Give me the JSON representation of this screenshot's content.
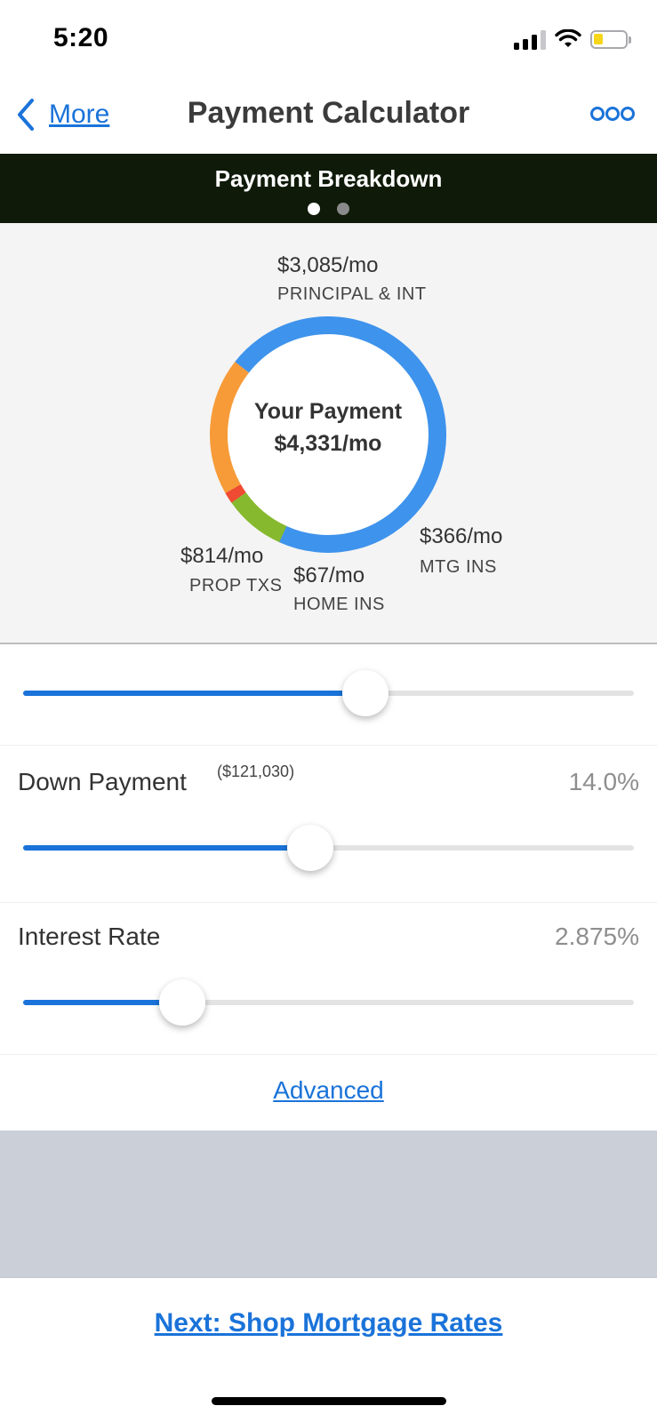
{
  "status_bar": {
    "time": "5:20"
  },
  "nav": {
    "back_label": "More",
    "title": "Payment Calculator"
  },
  "breakdown": {
    "title": "Payment Breakdown",
    "page_count": 2,
    "active_page": 1
  },
  "chart_data": {
    "type": "pie",
    "donut": true,
    "center_line1": "Your Payment",
    "center_line2": "$4,331/mo",
    "total": 4331,
    "slices": [
      {
        "name": "PRINCIPAL & INT",
        "amount": "$3,085/mo",
        "value": 3085,
        "color": "#3e93ec"
      },
      {
        "name": "MTG INS",
        "amount": "$366/mo",
        "value": 366,
        "color": "#86b92e"
      },
      {
        "name": "HOME INS",
        "amount": "$67/mo",
        "value": 67,
        "color": "#ee4b32"
      },
      {
        "name": "PROP TXS",
        "amount": "$814/mo",
        "value": 814,
        "color": "#f79b38"
      }
    ]
  },
  "sliders": {
    "home_price": {
      "fill_fraction": 0.56
    },
    "down_payment": {
      "label": "Down Payment",
      "amount": "($121,030)",
      "value": "14.0%",
      "fill_fraction": 0.47
    },
    "interest_rate": {
      "label": "Interest Rate",
      "value": "2.875%",
      "fill_fraction": 0.26
    }
  },
  "advanced_label": "Advanced",
  "next_label": "Next: Shop Mortgage Rates",
  "colors": {
    "accent": "#1a73d9",
    "header_bg": "#0f1a08",
    "panel_bg": "#f4f4f4"
  }
}
